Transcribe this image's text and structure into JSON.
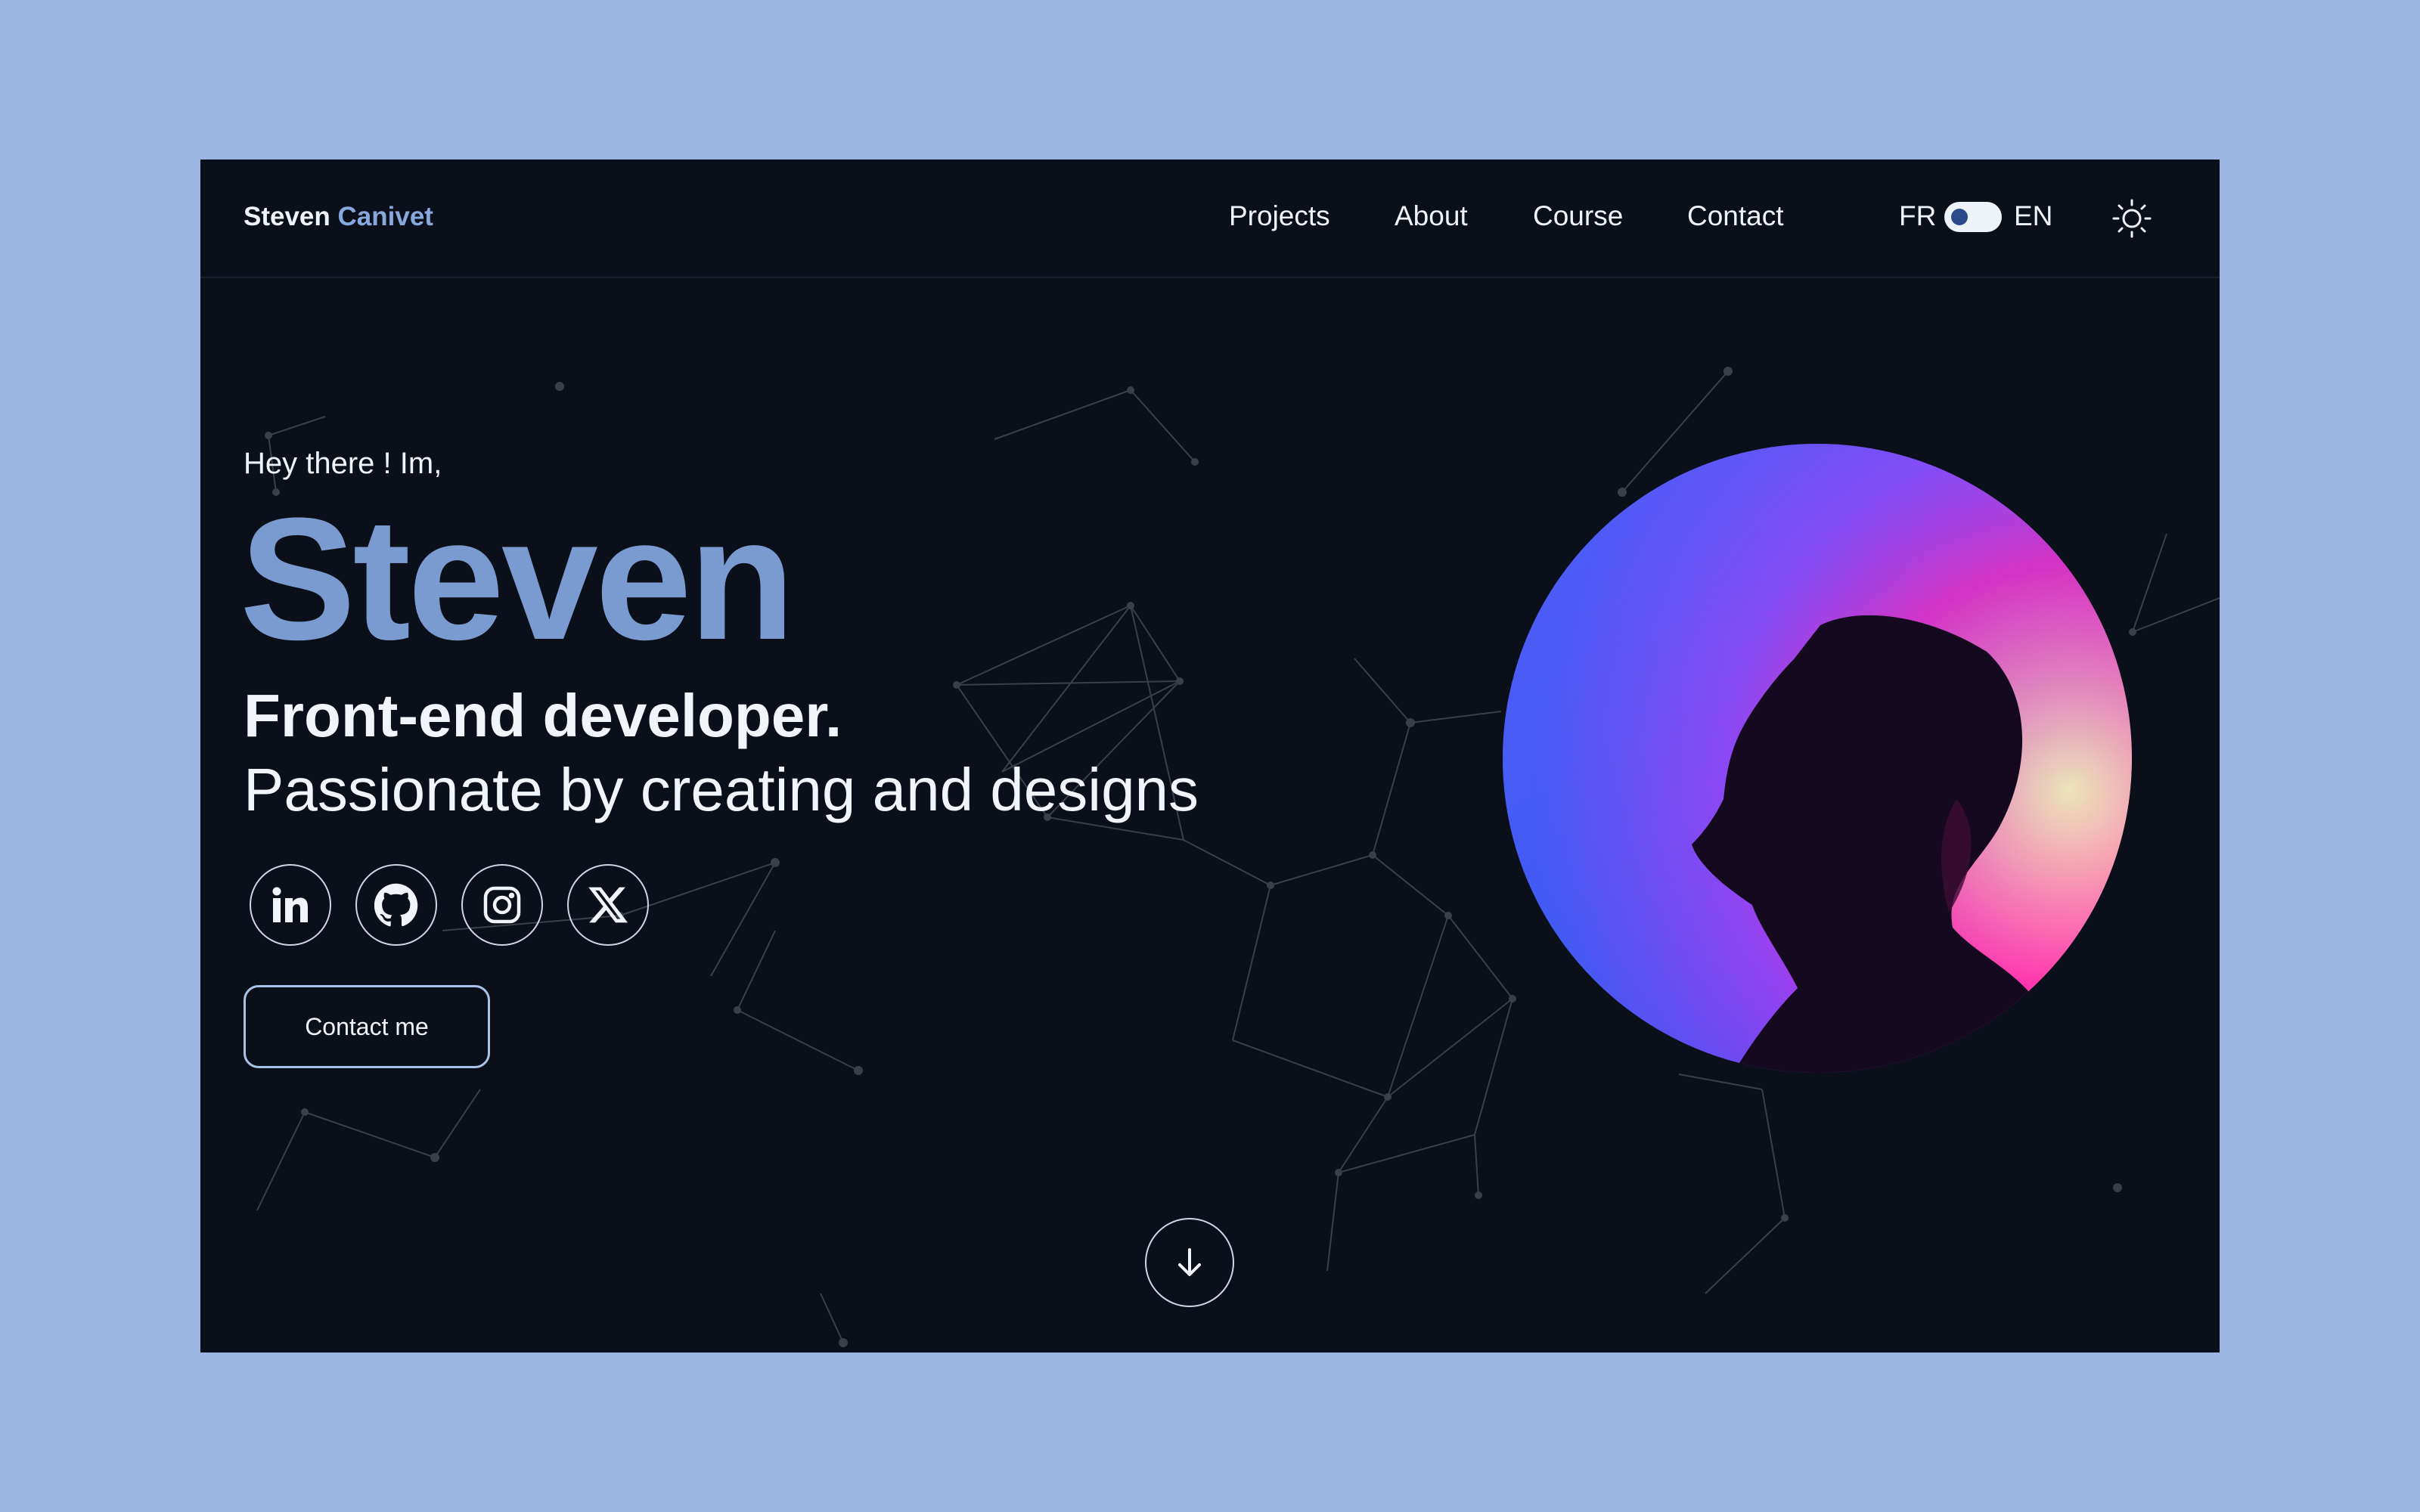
{
  "header": {
    "brand_first": "Steven",
    "brand_last": "Canivet",
    "nav": [
      "Projects",
      "About",
      "Course",
      "Contact"
    ],
    "lang_left": "FR",
    "lang_right": "EN",
    "theme_icon": "sun-icon"
  },
  "hero": {
    "greeting": "Hey there ! Im,",
    "name": "Steven",
    "headline": "Front-end developer.",
    "tagline": "Passionate by creating and designs",
    "socials": [
      "linkedin-icon",
      "github-icon",
      "instagram-icon",
      "x-icon"
    ],
    "cta": "Contact me",
    "scroll_icon": "arrow-down-icon"
  },
  "colors": {
    "page_background": "#9bb6e0",
    "window_background": "#0b0f19",
    "brand_accent": "#86a8dc",
    "text": "#eef2f9"
  }
}
